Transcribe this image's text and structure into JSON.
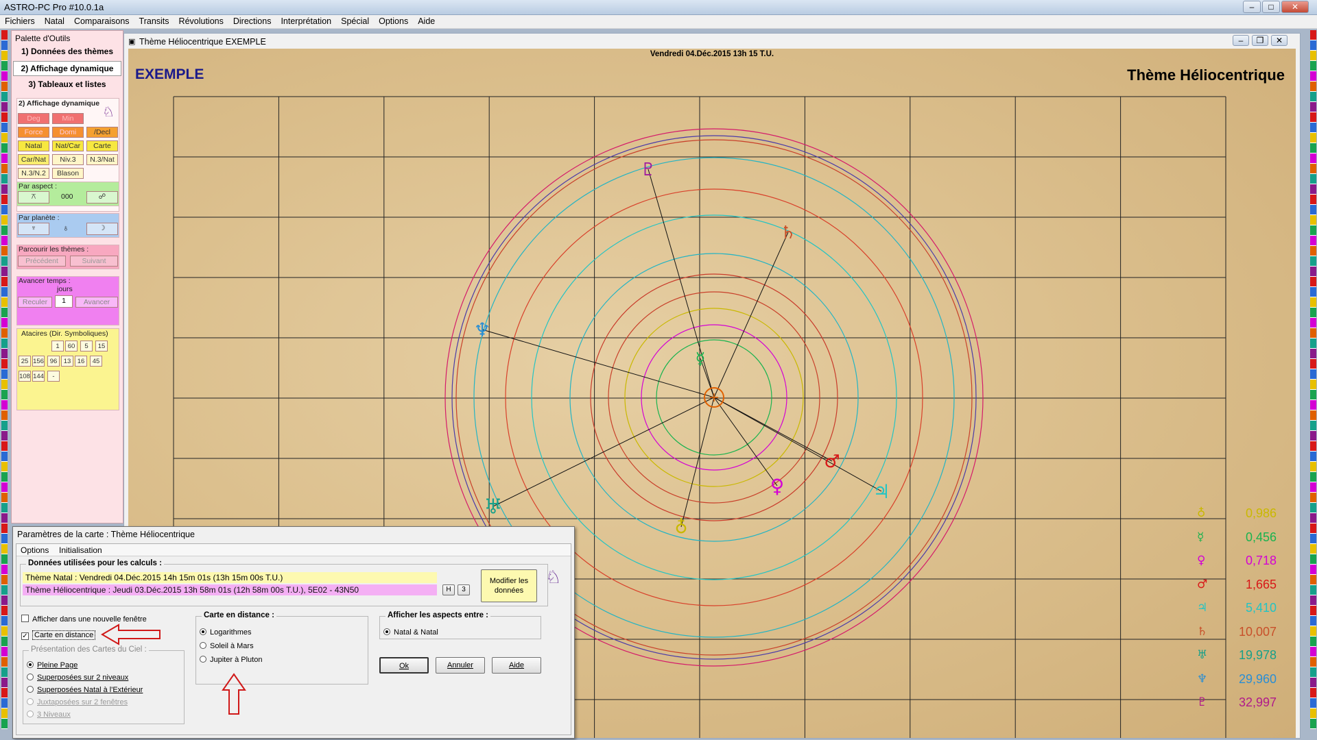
{
  "app": {
    "title": "ASTRO-PC Pro #10.0.1a"
  },
  "menu": [
    "Fichiers",
    "Natal",
    "Comparaisons",
    "Transits",
    "Révolutions",
    "Directions",
    "Interprétation",
    "Spécial",
    "Options",
    "Aide"
  ],
  "palette": {
    "title": "Palette d'Outils",
    "tabs": [
      "1) Données des thèmes",
      "2) Affichage dynamique",
      "3) Tableaux et listes"
    ],
    "section_title": "2) Affichage dynamique",
    "display_buttons": [
      "Deg",
      "Min",
      "Force",
      "Domi",
      "/Decl",
      "Natal",
      "Nat/Car",
      "Carte",
      "Car/Nat",
      "Niv.3",
      "N.3/Nat",
      "N.3/N.2",
      "Blason"
    ],
    "par_aspect": {
      "label": "Par aspect :",
      "value": "000"
    },
    "par_planete": {
      "label": "Par planète :"
    },
    "parcourir": {
      "label": "Parcourir les thèmes :",
      "prev": "Précédent",
      "next": "Suivant"
    },
    "avancer": {
      "label": "Avancer temps :",
      "unit": "jours",
      "value": "1",
      "back": "Reculer",
      "fwd": "Avancer"
    },
    "ataciers": {
      "label": "Atacires (Dir. Symboliques)",
      "values": [
        "1",
        "60",
        "5",
        "15",
        "25",
        "156",
        "96",
        "13",
        "16",
        "45",
        "108",
        "144",
        "-"
      ]
    }
  },
  "chart_window": {
    "title": "Thème Héliocentrique  EXEMPLE",
    "date": "Vendredi 04.Déc.2015 13h 15 T.U.",
    "name": "EXEMPLE",
    "chart_title": "Thème Héliocentrique"
  },
  "distances": [
    {
      "glyph": "♁",
      "value": "0,986",
      "color": "#c9b800"
    },
    {
      "glyph": "☿",
      "value": "0,456",
      "color": "#19b34f"
    },
    {
      "glyph": "♀",
      "value": "0,718",
      "color": "#d400d4"
    },
    {
      "glyph": "♂",
      "value": "1,665",
      "color": "#d81818"
    },
    {
      "glyph": "♃",
      "value": "5,410",
      "color": "#22c4c4"
    },
    {
      "glyph": "♄",
      "value": "10,007",
      "color": "#c8502a"
    },
    {
      "glyph": "♅",
      "value": "19,978",
      "color": "#16a08a"
    },
    {
      "glyph": "♆",
      "value": "29,960",
      "color": "#2a8ed4"
    },
    {
      "glyph": "♇",
      "value": "32,997",
      "color": "#b01a8a"
    }
  ],
  "dialog": {
    "title": "Paramètres de la carte : Thème Héliocentrique",
    "menu": [
      "Options",
      "Initialisation"
    ],
    "data_label": "Données utilisées pour les calculs :",
    "natal_line": "Thème Natal : Vendredi 04.Déc.2015 14h 15m 01s (13h 15m 00s T.U.)",
    "helio_line": "Thème Héliocentrique : Jeudi 03.Déc.2015 13h 58m 01s (12h 58m 00s T.U.), 5E02 - 43N50",
    "h_button": "H",
    "n_button": "3",
    "modify_button": "Modifier les données",
    "new_window_label": "Afficher dans une nouvelle fenêtre",
    "distance_label": "Carte en distance",
    "presentation_label": "Présentation des Cartes du Ciel :",
    "presentation_options": [
      "Pleine Page",
      "Superposées sur 2 niveaux",
      "Superposées Natal à l'Extérieur",
      "Juxtaposées sur 2 fenêtres",
      "3 Niveaux"
    ],
    "carte_distance_label": "Carte en distance :",
    "carte_distance_options": [
      "Logarithmes",
      "Soleil à Mars",
      "Jupiter à Pluton"
    ],
    "aspects_label": "Afficher les aspects entre :",
    "aspects_option": "Natal & Natal",
    "ok": "Ok",
    "cancel": "Annuler",
    "help": "Aide"
  }
}
